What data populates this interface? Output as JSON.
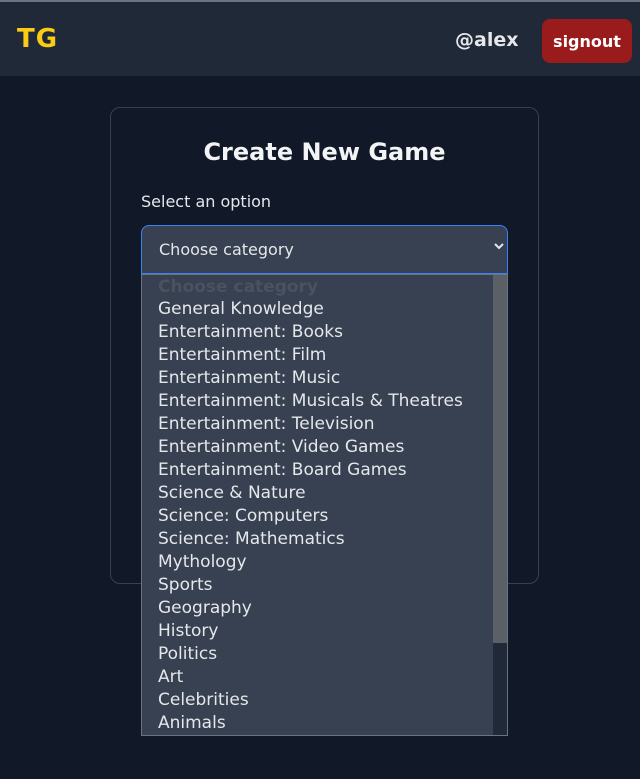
{
  "header": {
    "logo": "TG",
    "username": "@alex",
    "signout_label": "signout"
  },
  "card": {
    "title": "Create New Game",
    "field_label": "Select an option"
  },
  "select": {
    "value": "Choose category",
    "options": [
      "Choose category",
      "General Knowledge",
      "Entertainment: Books",
      "Entertainment: Film",
      "Entertainment: Music",
      "Entertainment: Musicals & Theatres",
      "Entertainment: Television",
      "Entertainment: Video Games",
      "Entertainment: Board Games",
      "Science & Nature",
      "Science: Computers",
      "Science: Mathematics",
      "Mythology",
      "Sports",
      "Geography",
      "History",
      "Politics",
      "Art",
      "Celebrities",
      "Animals"
    ]
  },
  "colors": {
    "page_background": "#111827",
    "header_background": "#1f2937",
    "logo": "#facc15",
    "signout_button": "#991b1b",
    "select_focus_border": "#3b82f6",
    "dropdown_background": "#374151"
  },
  "icons": {
    "select": "chevron-down-icon"
  }
}
